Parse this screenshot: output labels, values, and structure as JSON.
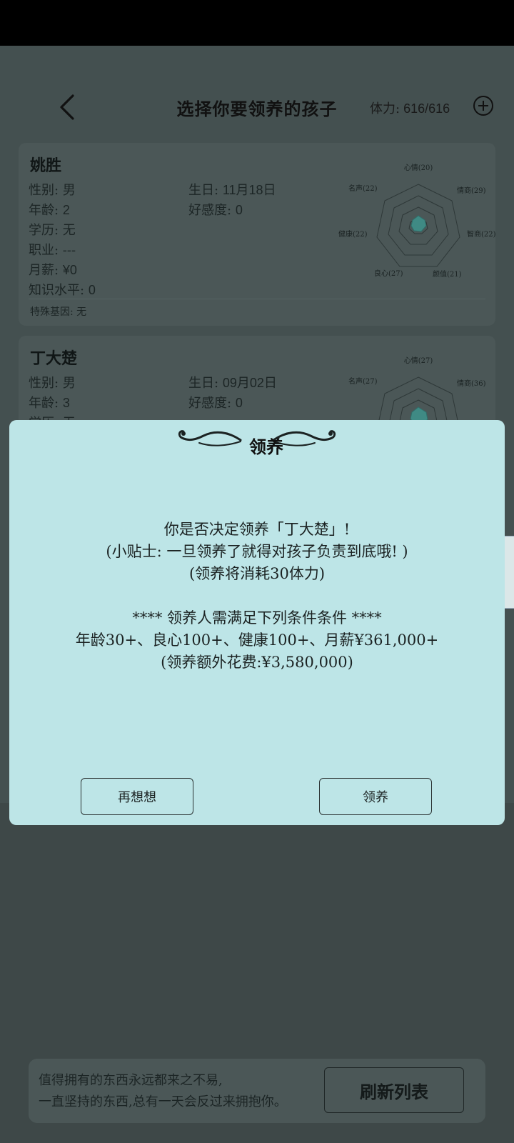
{
  "header": {
    "title": "选择你要领养的孩子",
    "stamina_label": "体力:",
    "stamina_value": "616/616"
  },
  "cards": [
    {
      "name": "姚胜",
      "gender": "性别: 男",
      "age_label": "年龄:",
      "age": "2",
      "education": "学历: 无",
      "job": "职业: ---",
      "salary_label": "月薪:",
      "salary": "¥0",
      "knowledge_label": "知识水平:",
      "knowledge": "0",
      "birthday_label": "生日:",
      "birthday": "11月18日",
      "favor_label": "好感度:",
      "favor": "0",
      "gene": "特殊基因: 无",
      "radar": {
        "mood": "心情(20)",
        "eq": "情商(29)",
        "iq": "智商(22)",
        "looks": "颜值(21)",
        "conscience": "良心(27)",
        "health": "健康(22)",
        "fame": "名声(22)"
      }
    },
    {
      "name": "丁大楚",
      "gender": "性别: 男",
      "age_label": "年龄:",
      "age": "3",
      "education": "学历: 无",
      "birthday_label": "生日:",
      "birthday": "09月02日",
      "favor_label": "好感度:",
      "favor": "0",
      "radar": {
        "mood": "心情(27)",
        "eq": "情商(36)",
        "fame": "名声(27)"
      }
    }
  ],
  "dialog": {
    "title": "领养",
    "line1": "你是否决定领养「丁大楚」!",
    "line2": "(小贴士: 一旦领养了就得对孩子负责到底哦! )",
    "line3": "(领养将消耗30体力)",
    "line4": "**** 领养人需满足下列条件条件 ****",
    "line5": "年龄30+、良心100+、健康100+、月薪¥361,000+",
    "line6": "(领养额外花费:¥3,580,000)",
    "cancel_label": "再想想",
    "confirm_label": "领养"
  },
  "footer": {
    "quote_line1": "值得拥有的东西永远都来之不易,",
    "quote_line2": "一直坚持的东西,总有一天会反过来拥抱你。",
    "refresh_label": "刷新列表"
  }
}
